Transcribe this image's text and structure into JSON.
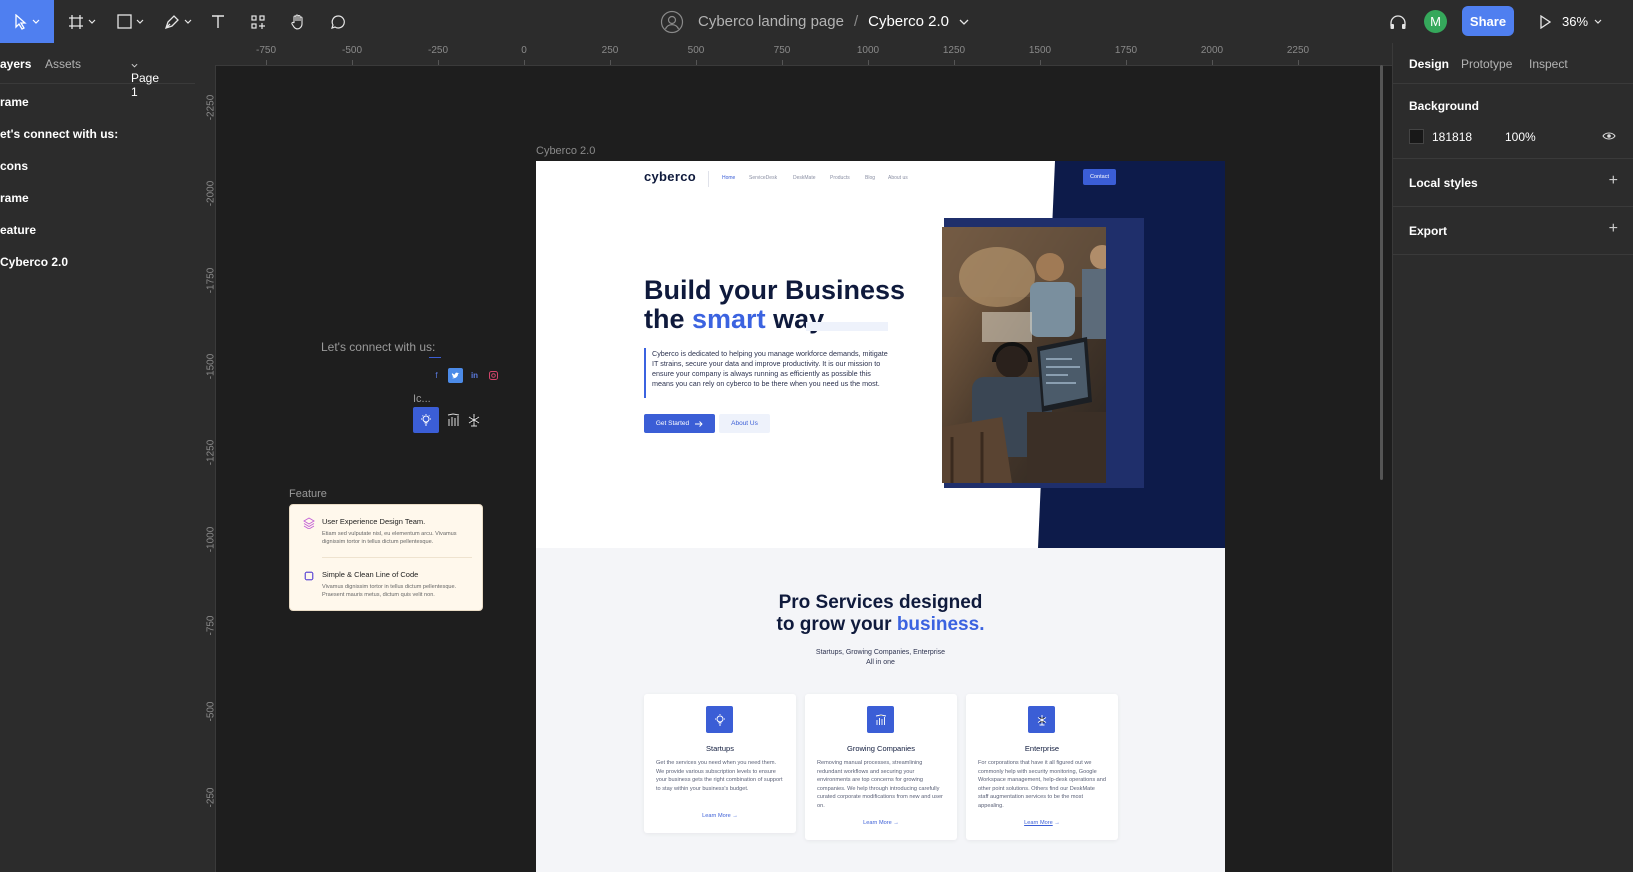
{
  "toolbar": {
    "file_project": "Cyberco landing page",
    "separator": "/",
    "file_name": "Cyberco 2.0",
    "avatar_initial": "M",
    "share_label": "Share",
    "zoom": "36%"
  },
  "left_panel": {
    "tabs": [
      "ayers",
      "Assets"
    ],
    "page": "Page 1",
    "layers": [
      "rame",
      "et's connect with us:",
      "cons",
      "rame",
      "eature",
      "Cyberco 2.0"
    ]
  },
  "right_panel": {
    "tabs": [
      "Design",
      "Prototype",
      "Inspect"
    ],
    "background_title": "Background",
    "bg_color": "181818",
    "bg_opacity": "100%",
    "local_styles": "Local styles",
    "export": "Export"
  },
  "ruler_top": [
    "-750",
    "-500",
    "-250",
    "0",
    "250",
    "500",
    "750",
    "1000",
    "1250",
    "1500",
    "1750",
    "2000",
    "2250"
  ],
  "ruler_left": [
    "-2250",
    "-2000",
    "-1750",
    "-1500",
    "-1250",
    "-1000",
    "-750",
    "-500",
    "-250"
  ],
  "canvas": {
    "frame_label": "Cyberco 2.0",
    "connect_label": "Let's connect with us:",
    "icons_label": "Ic...",
    "feature_label": "Feature"
  },
  "site": {
    "logo": "cyberco",
    "nav": [
      "Home",
      "ServiceDesk",
      "DeskMate",
      "Products",
      "Blog",
      "About us"
    ],
    "contact": "Contact",
    "hero_line1": "Build your Business",
    "hero_line2_a": "the ",
    "hero_line2_b": "smart",
    "hero_line2_c": " way",
    "hero_text": "Cyberco is dedicated to helping you manage workforce demands, mitigate IT strains, secure your data and improve productivity. It is our mission to ensure your company is always running as efficiently as possible this means you can rely on cyberco to be there when you need us the most.",
    "btn_primary": "Get Started",
    "btn_secondary": "About Us",
    "services_line1": "Pro Services designed",
    "services_line2_a": "to grow your ",
    "services_line2_b": "business.",
    "services_sub1": "Startups, Growing Companies, Enterprise",
    "services_sub2": "All in one",
    "cards": [
      {
        "title": "Startups",
        "text": "Get the services you need when you need them. We provide various subscription levels to ensure your business gets the right combination of support to stay within your business's budget.",
        "link": "Learn More"
      },
      {
        "title": "Growing Companies",
        "text": "Removing manual processes, streamlining redundant workflows and securing your environments are top concerns for growing companies. We help through introducing carefully curated corporate modifications from new and user on.",
        "link": "Learn More"
      },
      {
        "title": "Enterprise",
        "text": "For corporations that have it all figured out we commonly help with security monitoring, Google Workspace management, help-desk operations and other point solutions. Others find our DeskMate staff augmentation services to be the most appealing.",
        "link": "Learn More"
      }
    ]
  },
  "feature": {
    "items": [
      {
        "title": "User Experience Design Team.",
        "text": "Etiam sed vulputate nisl, eu elementum arcu. Vivamus dignissim tortor in tellus dictum pellentesque."
      },
      {
        "title": "Simple & Clean Line of Code",
        "text": "Vivamus dignissim tortor in tellus dictum pellentesque. Praesent mauris metus, dictum quis velit non."
      }
    ]
  },
  "colors": {
    "accent": "#4f7ff0",
    "site_navy": "#0d1b4a",
    "site_blue": "#3b5ed6"
  }
}
